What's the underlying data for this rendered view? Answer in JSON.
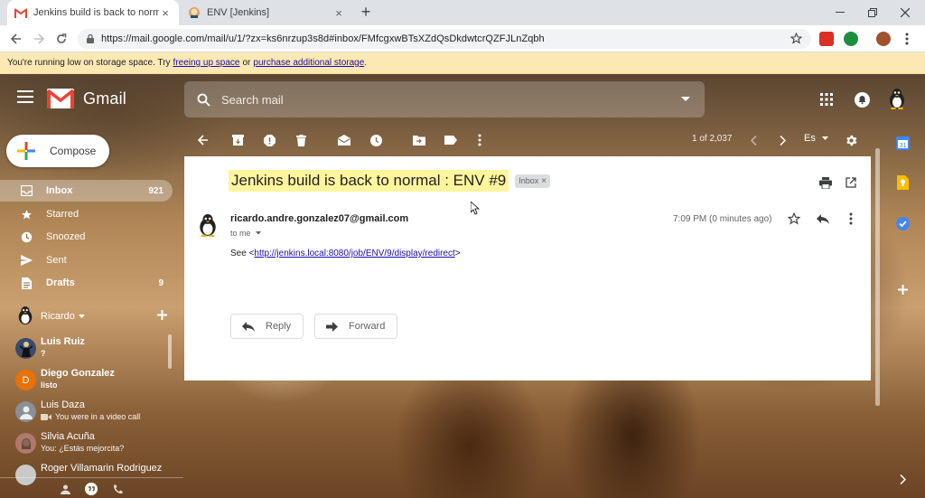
{
  "browser": {
    "tabs": [
      {
        "title": "Jenkins build is back to normal : E",
        "icon": "gmail-favicon",
        "active": true
      },
      {
        "title": "ENV [Jenkins]",
        "icon": "jenkins-favicon",
        "active": false
      }
    ],
    "url": "https://mail.google.com/mail/u/1/?zx=ks6nrzup3s8d#inbox/FMfcgxwBTsXZdQsDkdwtcrQZFJLnZqbh"
  },
  "banner": {
    "prefix": "You're running low on storage space. Try",
    "link1": "freeing up space",
    "middle": "or",
    "link2": "purchase additional storage",
    "suffix": "."
  },
  "gmail": {
    "brand": "Gmail",
    "search_placeholder": "Search mail",
    "compose_label": "Compose",
    "nav": [
      {
        "label": "Inbox",
        "count": "921",
        "icon": "inbox-icon"
      },
      {
        "label": "Starred",
        "count": "",
        "icon": "star-icon"
      },
      {
        "label": "Snoozed",
        "count": "",
        "icon": "clock-icon"
      },
      {
        "label": "Sent",
        "count": "",
        "icon": "send-icon"
      },
      {
        "label": "Drafts",
        "count": "9",
        "icon": "draft-icon"
      }
    ],
    "hangouts_user": "Ricardo",
    "contacts": [
      {
        "name": "Luis Ruiz",
        "status": "?",
        "bold": true,
        "avatar_color": "#3b4a6b",
        "initial": ""
      },
      {
        "name": "Diego Gonzalez",
        "status": "listo",
        "bold": true,
        "avatar_color": "#e8710a",
        "initial": "D"
      },
      {
        "name": "Luis Daza",
        "status": "You were in a video call",
        "bold": false,
        "avatar_color": "#8a8f99",
        "initial": ""
      },
      {
        "name": "Silvia Acuña",
        "status": "You: ¿Estás mejorcita?",
        "bold": false,
        "avatar_color": "#b07a6a",
        "initial": ""
      },
      {
        "name": "Roger Villamarin Rodriguez",
        "status": "",
        "bold": false,
        "avatar_color": "#c9c9c9",
        "initial": ""
      }
    ],
    "pager": "1 of 2,037",
    "language": "Es"
  },
  "message": {
    "subject": "Jenkins build is back to normal : ENV #9",
    "label_chip": "Inbox",
    "sender": "ricardo.andre.gonzalez07@gmail.com",
    "to": "to me",
    "time": "7:09 PM (0 minutes ago)",
    "body_prefix": "See <",
    "body_link": "http://jenkins.local:8080/job/ENV/9/display/redirect",
    "body_suffix": ">",
    "reply_label": "Reply",
    "forward_label": "Forward"
  },
  "colors": {
    "gmail_red": "#ea4335",
    "highlight": "#fff59d",
    "banner": "#fce8b2",
    "link": "#1a0dab"
  }
}
